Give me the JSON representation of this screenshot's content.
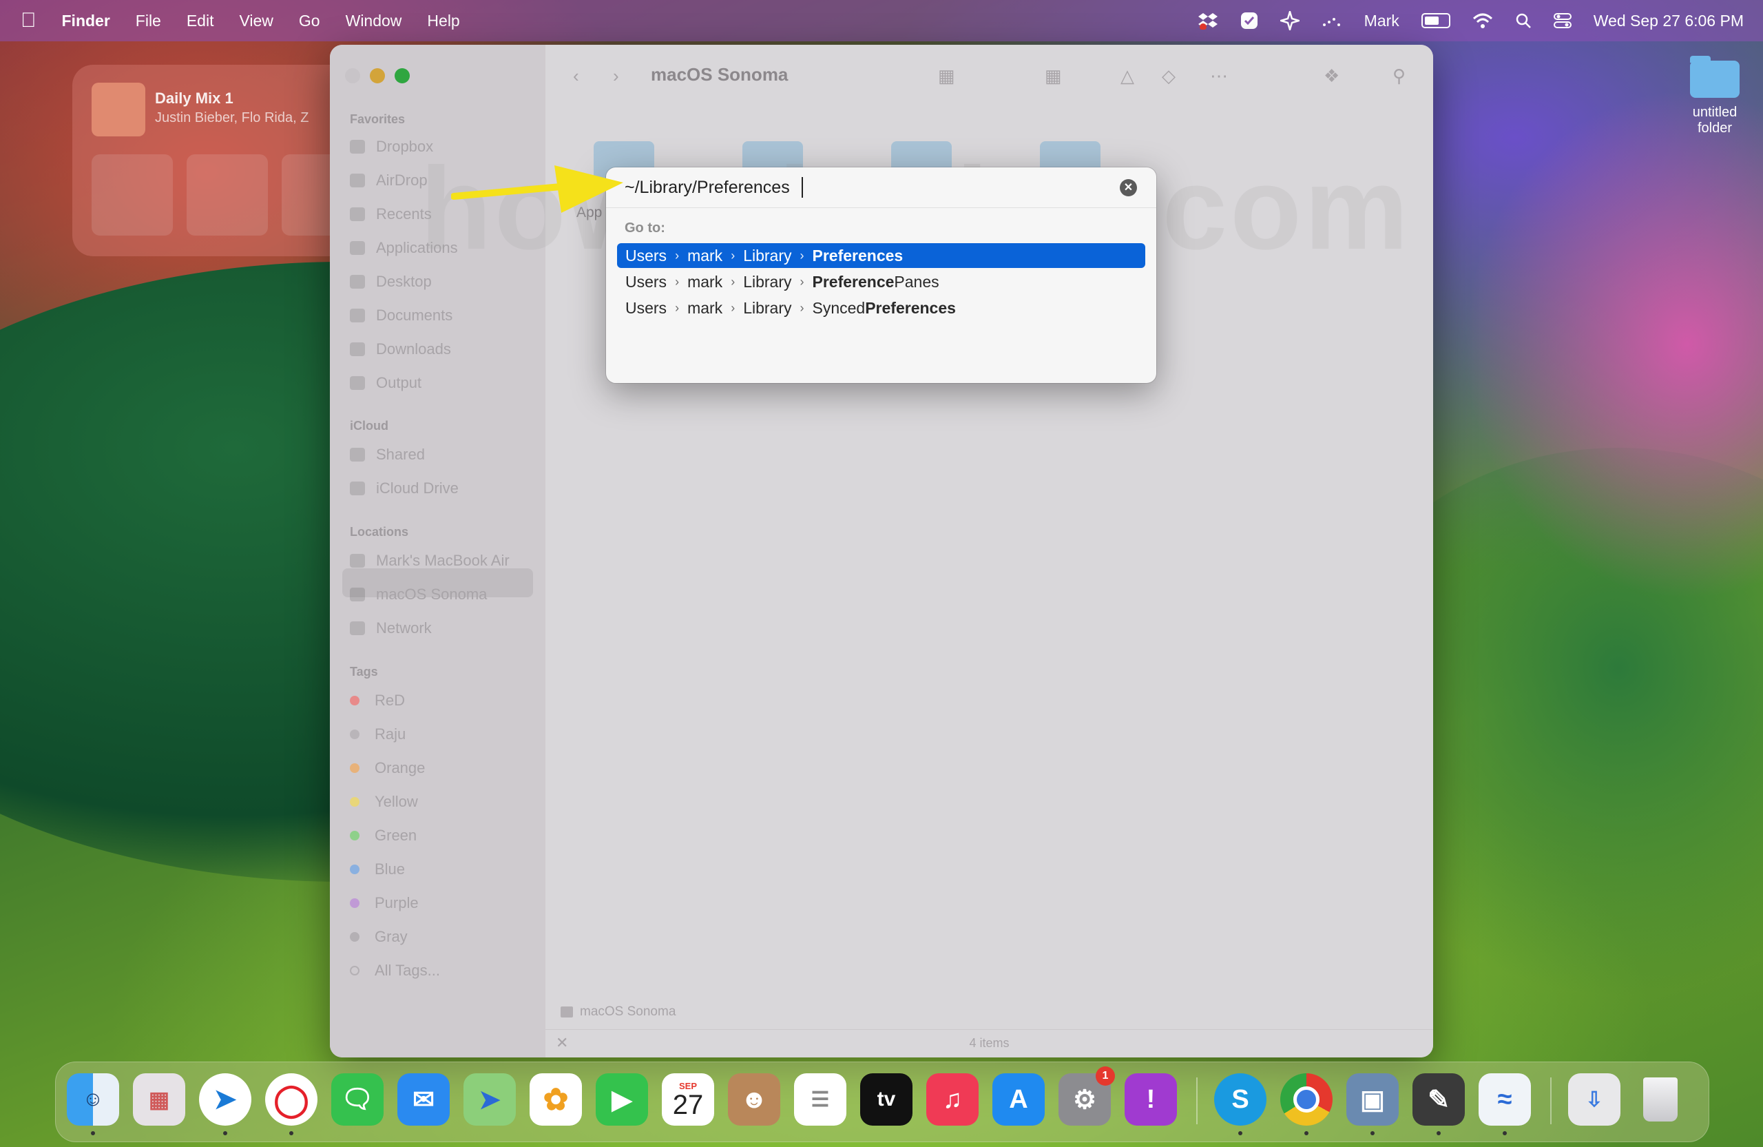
{
  "menubar": {
    "app_name": "Finder",
    "menus": [
      "File",
      "Edit",
      "View",
      "Go",
      "Window",
      "Help"
    ],
    "user": "Mark",
    "clock": "Wed Sep 27  6:06 PM"
  },
  "widget": {
    "title": "Daily Mix 1",
    "subtitle": "Justin Bieber, Flo Rida, Z"
  },
  "desktop_folder": {
    "label": "untitled folder"
  },
  "finder": {
    "title": "macOS Sonoma",
    "sidebar": {
      "favorites_header": "Favorites",
      "favorites": [
        "Dropbox",
        "AirDrop",
        "Recents",
        "Applications",
        "Desktop",
        "Documents",
        "Downloads",
        "Output"
      ],
      "icloud_header": "iCloud",
      "icloud": [
        "Shared",
        "iCloud Drive"
      ],
      "locations_header": "Locations",
      "locations": [
        "Mark's MacBook Air",
        "macOS Sonoma",
        "Network"
      ],
      "tags_header": "Tags",
      "tags": [
        {
          "label": "ReD",
          "color": "#e88a8a"
        },
        {
          "label": "Raju",
          "color": "#b9b5b9"
        },
        {
          "label": "Orange",
          "color": "#e8b27a"
        },
        {
          "label": "Yellow",
          "color": "#e8d67a"
        },
        {
          "label": "Green",
          "color": "#8ed08a"
        },
        {
          "label": "Blue",
          "color": "#8ab0e0"
        },
        {
          "label": "Purple",
          "color": "#c09ad6"
        },
        {
          "label": "Gray",
          "color": "#b4b0b4"
        },
        {
          "label": "All Tags...",
          "color": ""
        }
      ]
    },
    "partial_folder_label": "App",
    "pathbar": "macOS Sonoma",
    "status": "4 items"
  },
  "goto_dialog": {
    "input_value": "~/Library/Preferences",
    "goto_label": "Go to:",
    "suggestions": [
      {
        "segments": [
          "Users",
          "mark",
          "Library"
        ],
        "match": "Preferences",
        "rest": "",
        "prefix": ""
      },
      {
        "segments": [
          "Users",
          "mark",
          "Library"
        ],
        "match": "Preference",
        "rest": "Panes",
        "prefix": ""
      },
      {
        "segments": [
          "Users",
          "mark",
          "Library"
        ],
        "match": "Preferences",
        "rest": "",
        "prefix": "Synced"
      }
    ]
  },
  "watermark": "howtoisolve.com",
  "dock": {
    "calendar_month": "SEP",
    "calendar_day": "27",
    "settings_badge": "1",
    "apps": [
      "finder-icon",
      "launchpad-icon",
      "safari-icon",
      "opera-icon",
      "messages-icon",
      "mail-icon",
      "maps-icon",
      "photos-icon",
      "facetime-icon",
      "calendar-icon",
      "contacts-icon",
      "reminders-icon",
      "appletv-icon",
      "music-icon",
      "appstore-icon",
      "system-settings-icon",
      "feedback-icon",
      "skype-icon",
      "chrome-icon",
      "preview-icon",
      "script-editor-icon",
      "freeform-icon",
      "downloads-stack-icon",
      "trash-icon"
    ]
  },
  "accent": "#0a63d8",
  "annotation_color": "#f5e11a"
}
